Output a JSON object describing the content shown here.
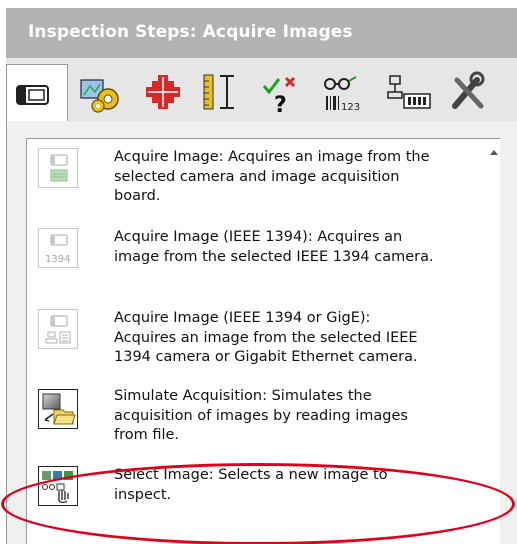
{
  "panel": {
    "title": "Inspection Steps: Acquire Images"
  },
  "tabs": [
    {
      "icon": "camera-icon",
      "selected": true
    },
    {
      "icon": "processing-gears-icon",
      "selected": false
    },
    {
      "icon": "locate-crosshair-icon",
      "selected": false
    },
    {
      "icon": "measure-ruler-icon",
      "selected": false
    },
    {
      "icon": "check-pass-fail-icon",
      "selected": false
    },
    {
      "icon": "identify-barcode-icon",
      "selected": false
    },
    {
      "icon": "communicate-io-icon",
      "selected": false
    },
    {
      "icon": "tools-icon",
      "selected": false
    }
  ],
  "steps": [
    {
      "name": "Acquire Image",
      "line1": "Acquire Image:  Acquires an image from the",
      "line2": "selected camera and image acquisition",
      "line3": "board.",
      "icon": "acquire-image-icon",
      "enabled": false
    },
    {
      "name": "Acquire Image (IEEE 1394)",
      "line1": "Acquire Image (IEEE 1394):  Acquires an",
      "line2": "image from the selected IEEE 1394 camera.",
      "line3": "",
      "icon_label": "1394",
      "icon": "acquire-1394-icon",
      "enabled": false
    },
    {
      "name": "Acquire Image (IEEE 1394 or GigE)",
      "line1": "Acquire Image (IEEE 1394 or GigE):",
      "line2": "Acquires an image from the selected IEEE",
      "line3": "1394 camera or Gigabit Ethernet camera.",
      "icon": "acquire-gige-icon",
      "enabled": false
    },
    {
      "name": "Simulate Acquisition",
      "line1": "Simulate Acquisition:  Simulates the",
      "line2": "acquisition of images by reading images",
      "line3": "from file.",
      "icon": "simulate-folder-icon",
      "enabled": true
    },
    {
      "name": "Select Image",
      "line1": "Select Image:  Selects a new image to",
      "line2": "inspect.",
      "line3": "",
      "icon": "select-image-icon",
      "enabled": true,
      "highlighted": true
    }
  ],
  "colors": {
    "title_bar": "#b3b3b3",
    "highlight_ring": "#e0001b",
    "disabled_icon": "#b8b8b8"
  }
}
